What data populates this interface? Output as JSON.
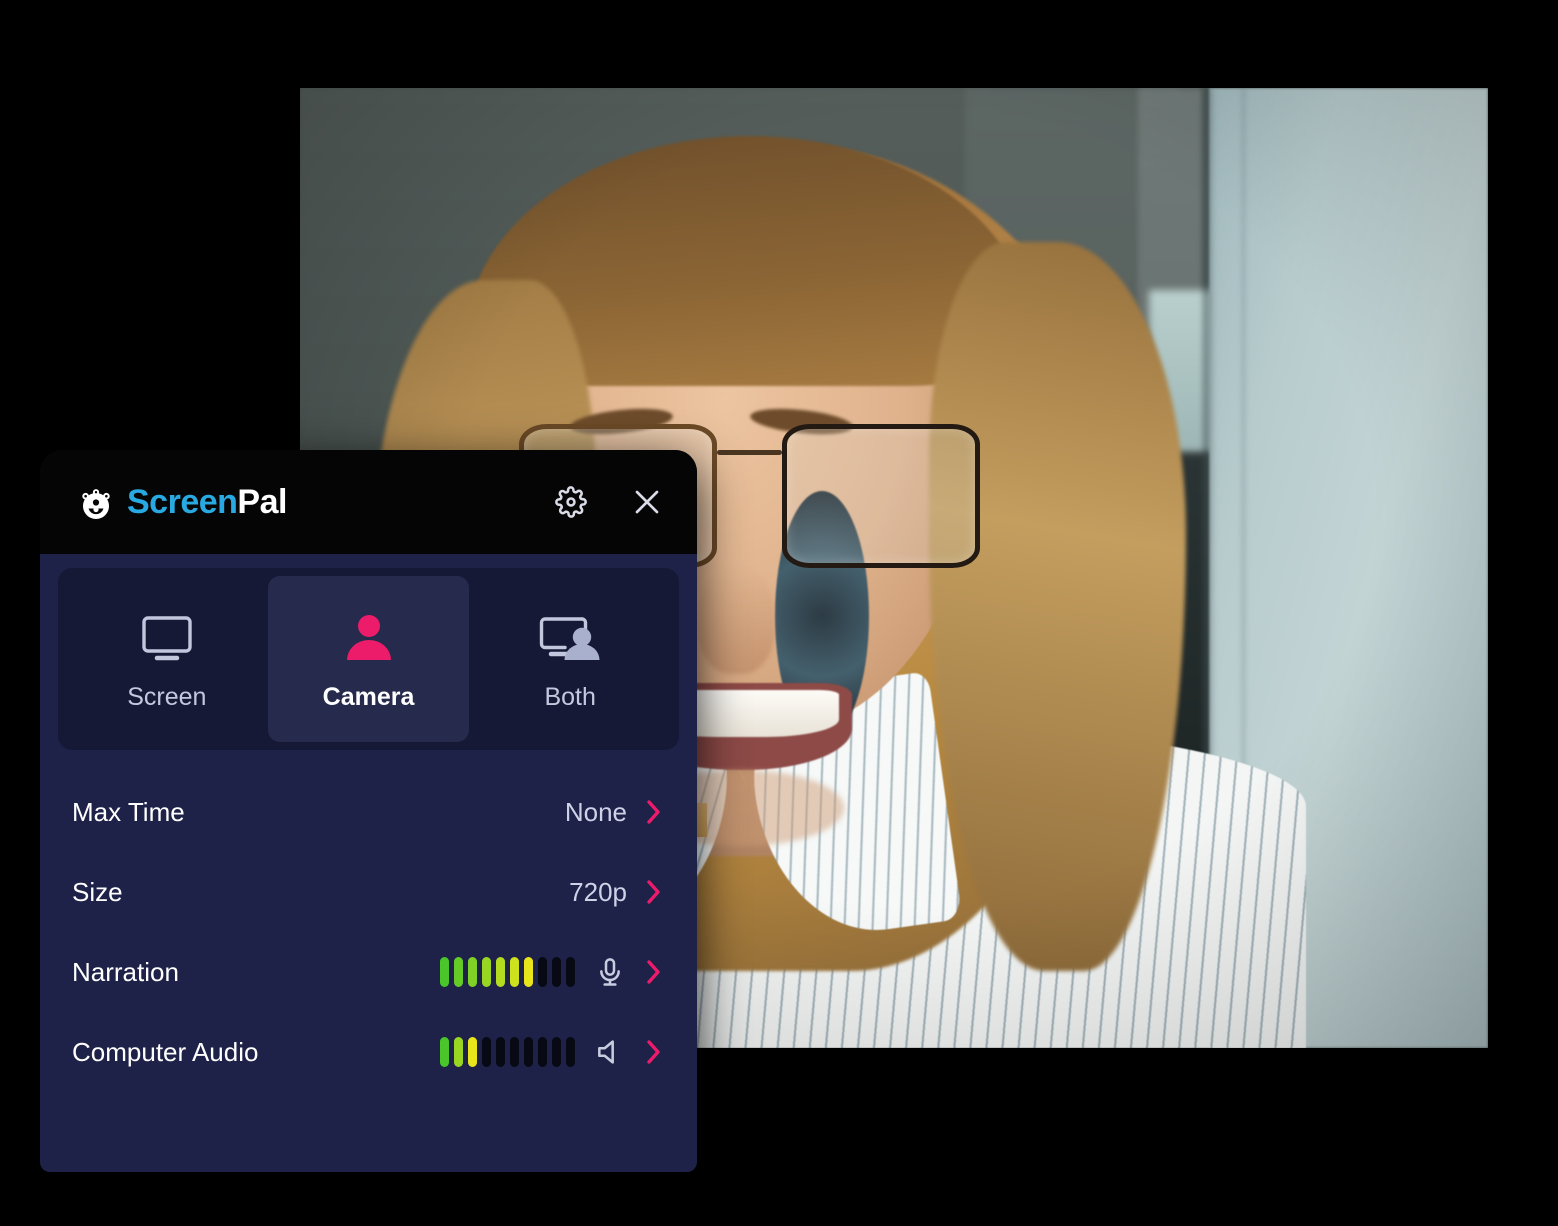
{
  "app": {
    "brand_screen": "Screen",
    "brand_pal": "Pal",
    "logo_icon": "screenpal-logo-icon",
    "accent_pink": "#ec1c6a",
    "accent_blue": "#29a9e1",
    "panel_bg": "#1e2148",
    "header_bg": "#050506",
    "tabs_bg": "#161935"
  },
  "header": {
    "settings_icon": "gear-icon",
    "close_icon": "close-icon"
  },
  "mode_tabs": [
    {
      "label": "Screen",
      "icon": "monitor-icon",
      "selected": false
    },
    {
      "label": "Camera",
      "icon": "person-icon",
      "selected": true
    },
    {
      "label": "Both",
      "icon": "monitor-person-icon",
      "selected": false
    }
  ],
  "settings": [
    {
      "label": "Max Time",
      "value": "None",
      "type": "value",
      "chevron_icon": "chevron-right-icon"
    },
    {
      "label": "Size",
      "value": "720p",
      "type": "value",
      "chevron_icon": "chevron-right-icon"
    },
    {
      "label": "Narration",
      "type": "meter",
      "meter": {
        "total": 10,
        "lit": 7
      },
      "device_icon": "microphone-icon",
      "chevron_icon": "chevron-right-icon"
    },
    {
      "label": "Computer Audio",
      "type": "meter",
      "meter": {
        "total": 10,
        "lit": 3
      },
      "device_icon": "speaker-icon",
      "chevron_icon": "chevron-right-icon"
    }
  ],
  "video_preview": {
    "description": "Smiling woman with tortoiseshell glasses, blonde wavy hair, white pinstriped shirt, gold bar necklace, blurred grey-green wall background",
    "icon": "camera-preview"
  }
}
